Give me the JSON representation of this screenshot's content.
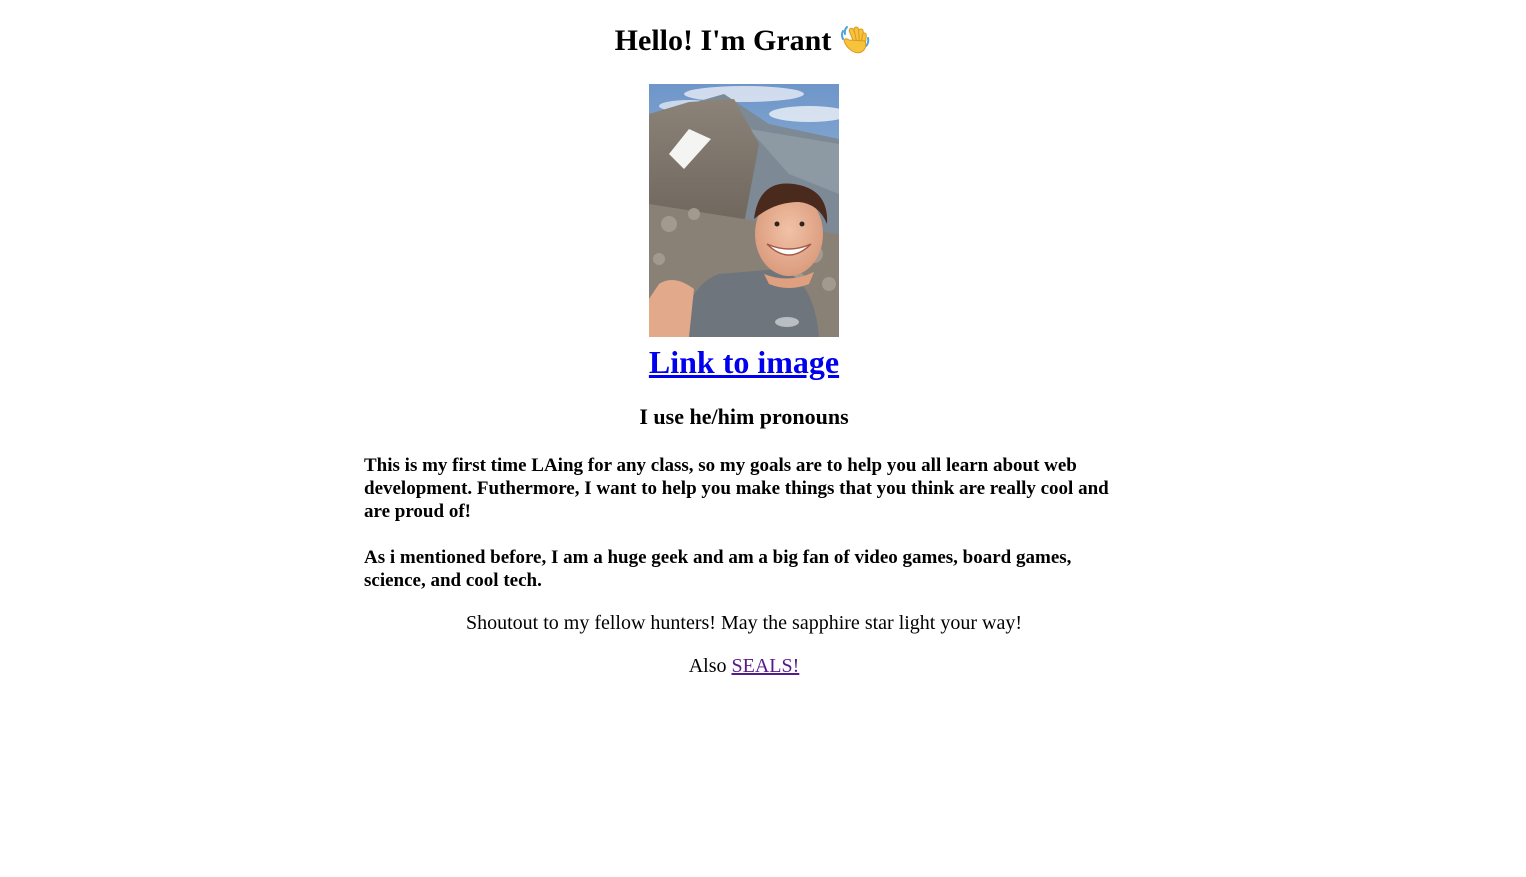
{
  "header": {
    "title": "Hello! I'm Grant",
    "emoji": "👋",
    "emoji_icon": "waving-hand-icon"
  },
  "photo": {
    "alt": "",
    "description_icon": "selfie-on-mountain-photo"
  },
  "image_link": {
    "label": "Link to image"
  },
  "pronouns": {
    "text": "I use he/him pronouns"
  },
  "bio": {
    "paragraph_1": "This is my first time LAing for any class, so my goals are to help you all learn about web development. Futhermore, I want to help you make things that you think are really cool and are proud of!",
    "paragraph_2": "As i mentioned before, I am a huge geek and am a big fan of video games, board games, science, and cool tech."
  },
  "shoutout": {
    "text": "Shoutout to my fellow hunters! May the sapphire star light your way!"
  },
  "also": {
    "prefix": "Also",
    "link_label": "SEALS!"
  },
  "colors": {
    "link": "#0000ee",
    "visited_link": "#551a8b",
    "text": "#000000",
    "background": "#ffffff"
  }
}
